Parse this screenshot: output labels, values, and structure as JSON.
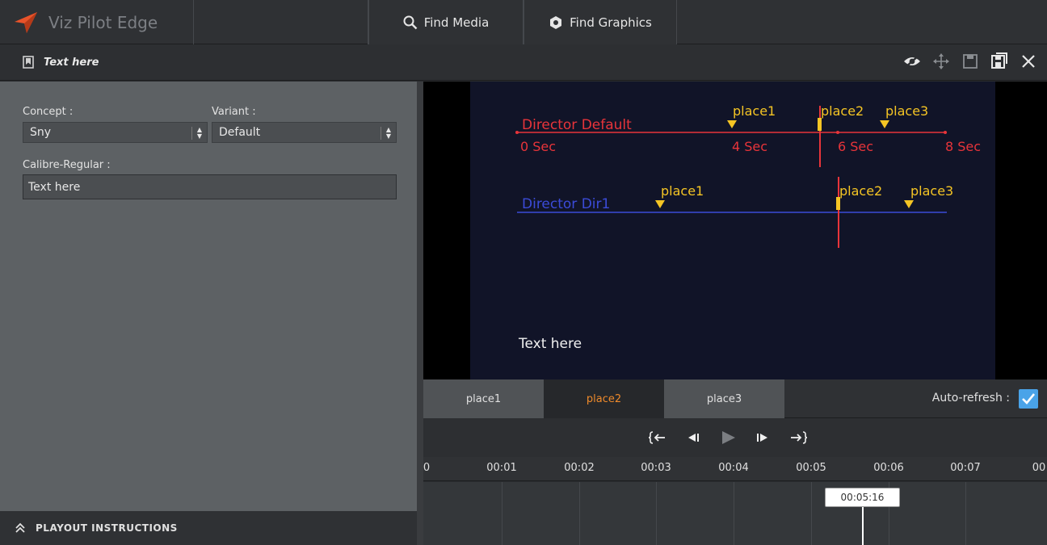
{
  "app": {
    "title": "Viz Pilot Edge"
  },
  "topbar": {
    "find_media": "Find Media",
    "find_graphics": "Find Graphics"
  },
  "template_bar": {
    "title": "Text here",
    "icons": [
      "hide-icon",
      "move-icon",
      "save-icon",
      "save-as-icon",
      "close-icon"
    ]
  },
  "form": {
    "concept_label": "Concept :",
    "concept_value": "Sny",
    "variant_label": "Variant :",
    "variant_value": "Default",
    "field_label": "Calibre-Regular :",
    "field_value": "Text here"
  },
  "playout": {
    "label": "PLAYOUT INSTRUCTIONS"
  },
  "preview": {
    "director_default": {
      "label": "Director Default",
      "time_labels": [
        "0 Sec",
        "4 Sec",
        "6 Sec",
        "8 Sec"
      ],
      "places": [
        "place1",
        "place2",
        "place3"
      ]
    },
    "director_dir1": {
      "label": "Director Dir1",
      "places": [
        "place1",
        "place2",
        "place3"
      ]
    },
    "scene_text": "Text here",
    "colors": {
      "default_line": "#e8343a",
      "dir1_line": "#3b4bd8",
      "marker": "#f5c524"
    }
  },
  "tabs": [
    {
      "label": "place1",
      "active": false
    },
    {
      "label": "place2",
      "active": true
    },
    {
      "label": "place3",
      "active": false
    }
  ],
  "auto_refresh": {
    "label": "Auto-refresh :",
    "checked": true
  },
  "timeline": {
    "ticks": [
      "0",
      "00:01",
      "00:02",
      "00:03",
      "00:04",
      "00:05",
      "00:06",
      "00:07",
      "00"
    ],
    "cursor": "00:05:16"
  },
  "accent_color": "#ef8a2b"
}
